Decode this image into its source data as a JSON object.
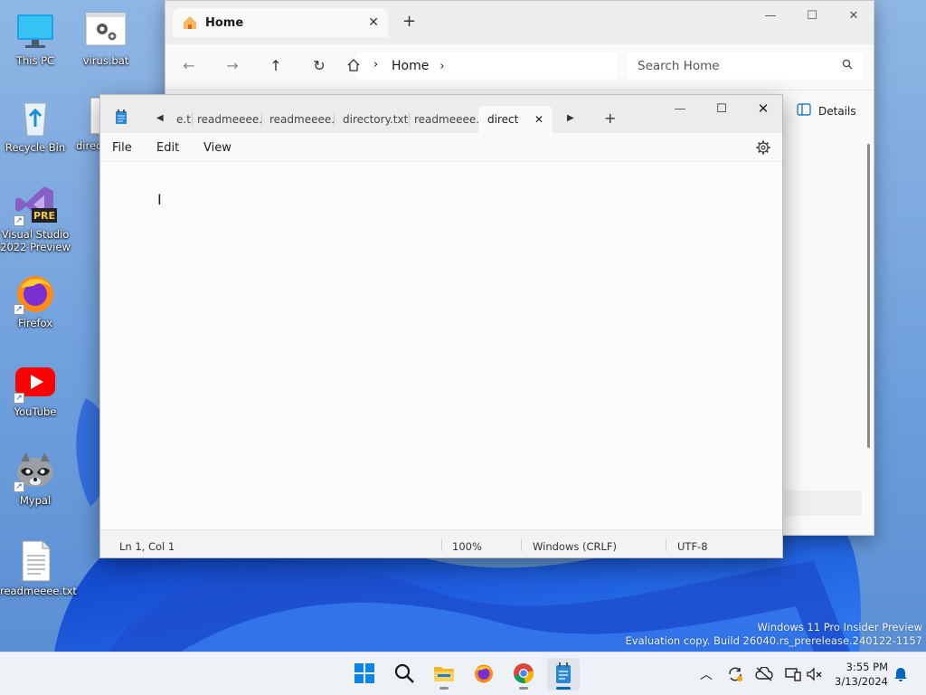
{
  "desktop": {
    "icons": [
      {
        "label": "This PC"
      },
      {
        "label": "virus.bat"
      },
      {
        "label": "Recycle Bin"
      },
      {
        "label": "direc"
      },
      {
        "label": "Visual Studio 2022 Preview",
        "badge": "PRE"
      },
      {
        "label": "Firefox"
      },
      {
        "label": "YouTube"
      },
      {
        "label": "Mypal"
      },
      {
        "label": "readmeeee.txt"
      }
    ]
  },
  "explorer": {
    "tab_title": "Home",
    "new_tab_glyph": "+",
    "address": {
      "segment": "Home"
    },
    "search_placeholder": "Search Home",
    "details_label": "Details"
  },
  "notepad": {
    "tabs": [
      {
        "label": "e.t"
      },
      {
        "label": "readmeeee.t"
      },
      {
        "label": "readmeeee.t"
      },
      {
        "label": "directory.txt"
      },
      {
        "label": "readmeeee.t"
      },
      {
        "label": "direct",
        "active": true
      }
    ],
    "menu": {
      "file": "File",
      "edit": "Edit",
      "view": "View"
    },
    "status": {
      "position": "Ln 1, Col 1",
      "zoom": "100%",
      "line_ending": "Windows (CRLF)",
      "encoding": "UTF-8"
    }
  },
  "watermark": {
    "line1": "Windows 11 Pro Insider Preview",
    "line2": "Evaluation copy. Build 26040.rs_prerelease.240122-1157"
  },
  "taskbar": {
    "time": "3:55 PM",
    "date": "3/13/2024"
  },
  "colors": {
    "accent": "#0067c0",
    "wallpaper_blue": "#1a56d6"
  }
}
